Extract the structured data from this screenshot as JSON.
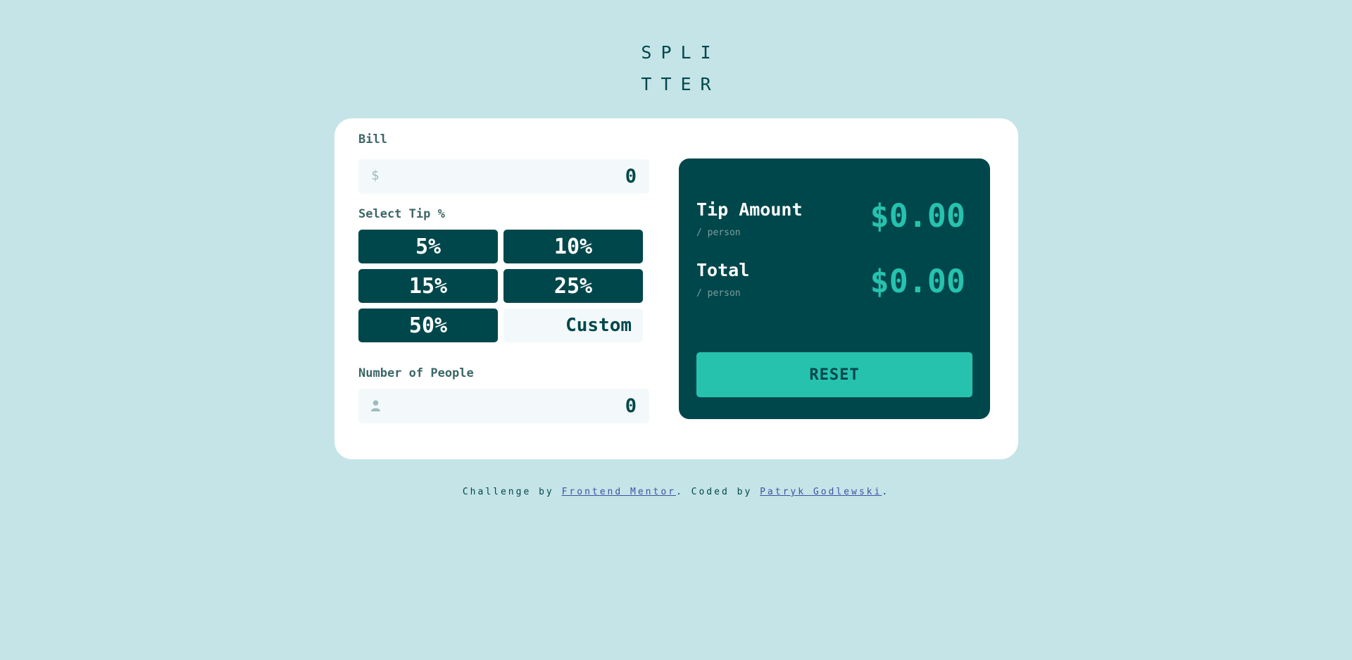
{
  "logo": {
    "line1": "SPLI",
    "line2": "TTER"
  },
  "bill": {
    "label": "Bill",
    "currency_icon": "$",
    "value": "0"
  },
  "tip": {
    "label": "Select Tip %",
    "options": [
      "5%",
      "10%",
      "15%",
      "25%",
      "50%"
    ],
    "custom_label": "Custom"
  },
  "people": {
    "label": "Number of People",
    "icon": "person-icon",
    "value": "0"
  },
  "results": {
    "tip_amount": {
      "title": "Tip Amount",
      "sub": "/ person",
      "value": "$0.00"
    },
    "total": {
      "title": "Total",
      "sub": "/ person",
      "value": "$0.00"
    },
    "reset_label": "RESET"
  },
  "footer": {
    "prefix": "Challenge by ",
    "link1": "Frontend Mentor",
    "middle": ". Coded by ",
    "link2": "Patryk Godlewski",
    "suffix": "."
  },
  "colors": {
    "background": "#c5e4e7",
    "dark_green": "#00474b",
    "accent": "#26c2ae",
    "input_bg": "#f3f9fa"
  }
}
